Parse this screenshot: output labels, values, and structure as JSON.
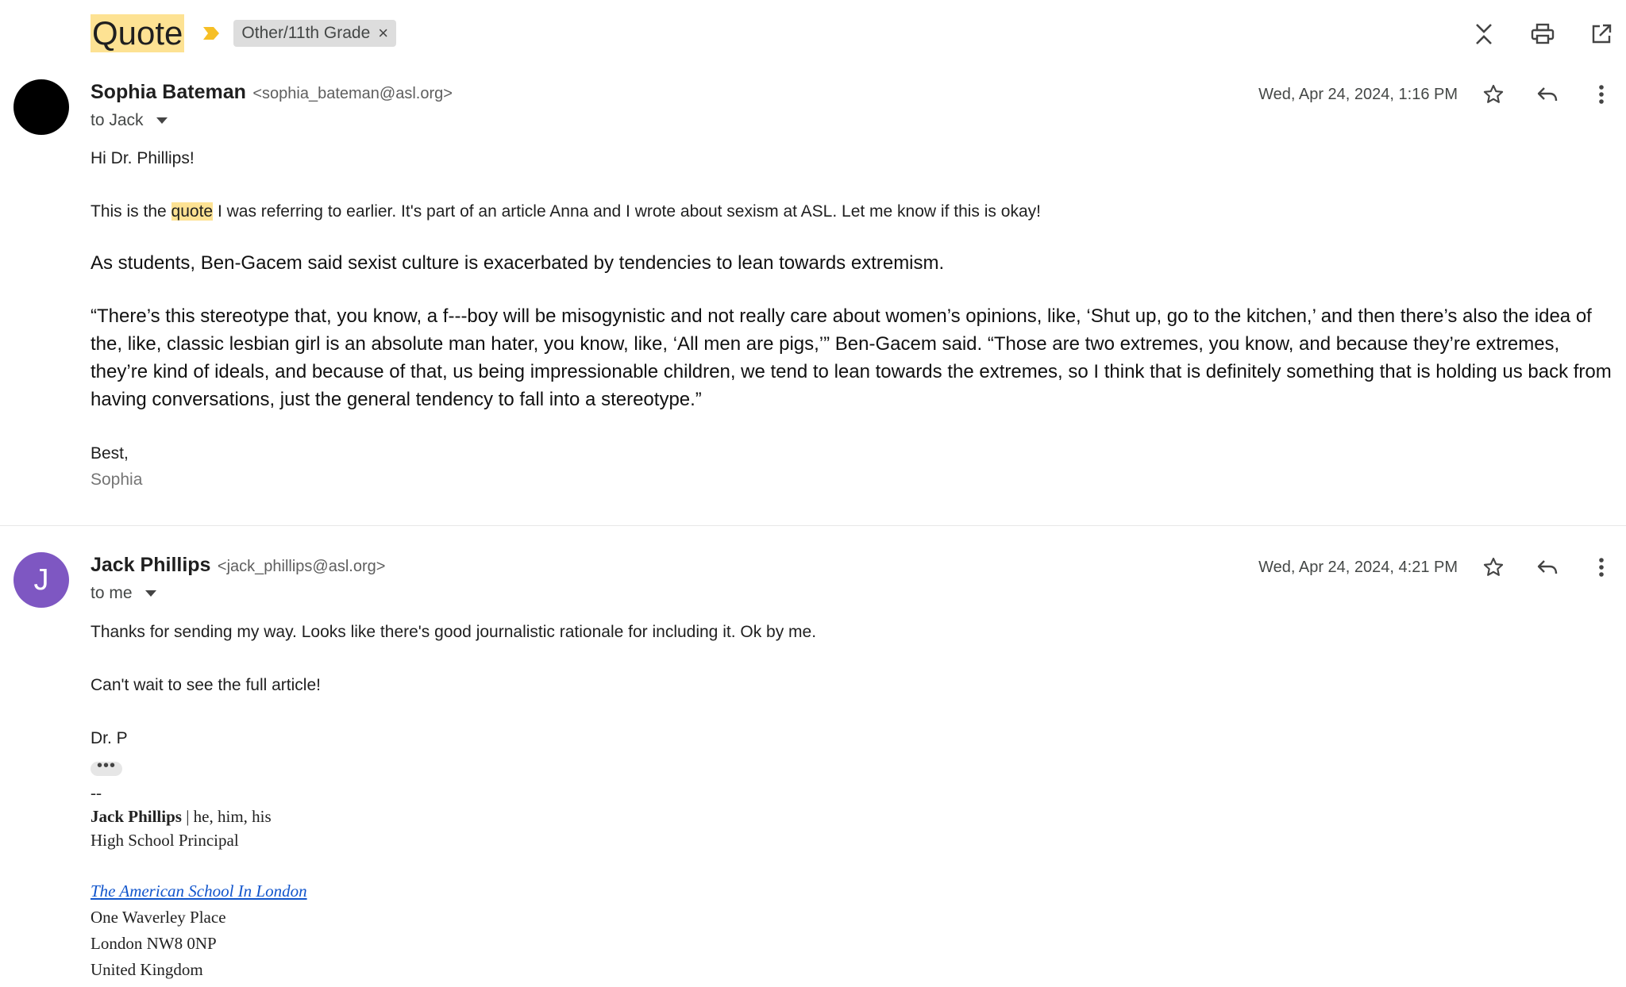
{
  "thread": {
    "subject": "Quote",
    "label": "Other/11th Grade"
  },
  "toolbar": {
    "icons": [
      "collapse-icon",
      "print-icon",
      "open-in-new-icon"
    ]
  },
  "messages": [
    {
      "sender_name": "Sophia Bateman",
      "sender_email": "<sophia_bateman@asl.org>",
      "to": "to Jack",
      "date": "Wed, Apr 24, 2024, 1:16 PM",
      "greeting": "Hi Dr. Phillips!",
      "p1_before": "This is the ",
      "p1_highlight": "quote",
      "p1_after": " I was referring to earlier. It's part of an article Anna and I wrote about sexism at ASL. Let me know if this is okay!",
      "quote_intro": "As students, Ben-Gacem said sexist culture is exacerbated by tendencies to lean towards extremism.",
      "quote_body": "“There’s this stereotype that, you know, a f---boy will be misogynistic and not really care about women’s opinions, like, ‘Shut up, go to the kitchen,’ and then there’s also the idea of the, like, classic lesbian girl is an absolute man hater, you know, like, ‘All men are pigs,’” Ben-Gacem said. “Those are two extremes, you know, and because they’re extremes, they’re kind of ideals, and because of that, us being impressionable children, we tend to lean towards the extremes, so I think that is definitely something that is holding us back from having conversations, just the general tendency to fall into a stereotype.”",
      "closing": "Best,",
      "signature": "Sophia"
    },
    {
      "avatar_letter": "J",
      "sender_name": "Jack Phillips",
      "sender_email": "<jack_phillips@asl.org>",
      "to": "to me",
      "date": "Wed, Apr 24, 2024, 4:21 PM",
      "p1": "Thanks for sending my way. Looks like there's good journalistic rationale for including it. Ok by me.",
      "p2": "Can't wait to see the full article!",
      "signoff": "Dr. P",
      "trimmed": "•••",
      "sig_dash": "--",
      "sig_name": "Jack Phillips",
      "sig_pronouns": " | he, him, his",
      "sig_title": "High School Principal",
      "sig_school": "The American School In London",
      "sig_addr1": "One Waverley Place",
      "sig_addr2": "London NW8 0NP",
      "sig_addr3": "United Kingdom"
    }
  ]
}
